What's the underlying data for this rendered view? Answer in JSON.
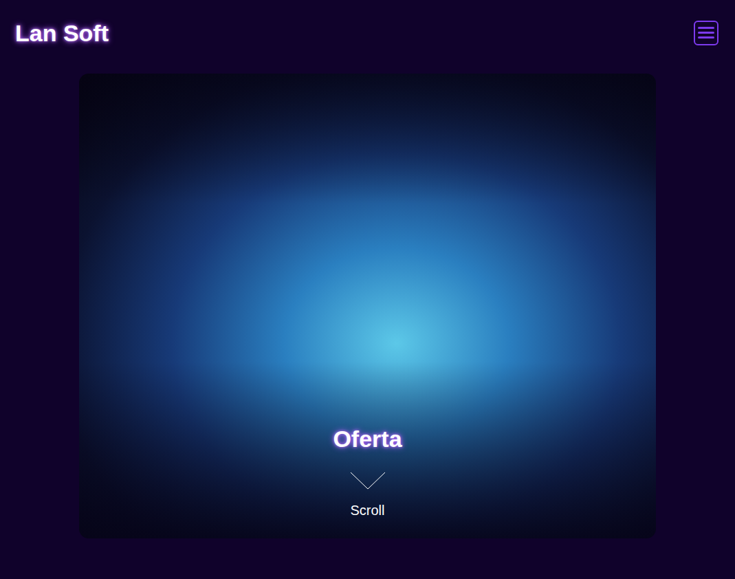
{
  "header": {
    "title": "Lan Soft"
  },
  "hero": {
    "title": "Oferta",
    "scroll_label": "Scroll"
  }
}
